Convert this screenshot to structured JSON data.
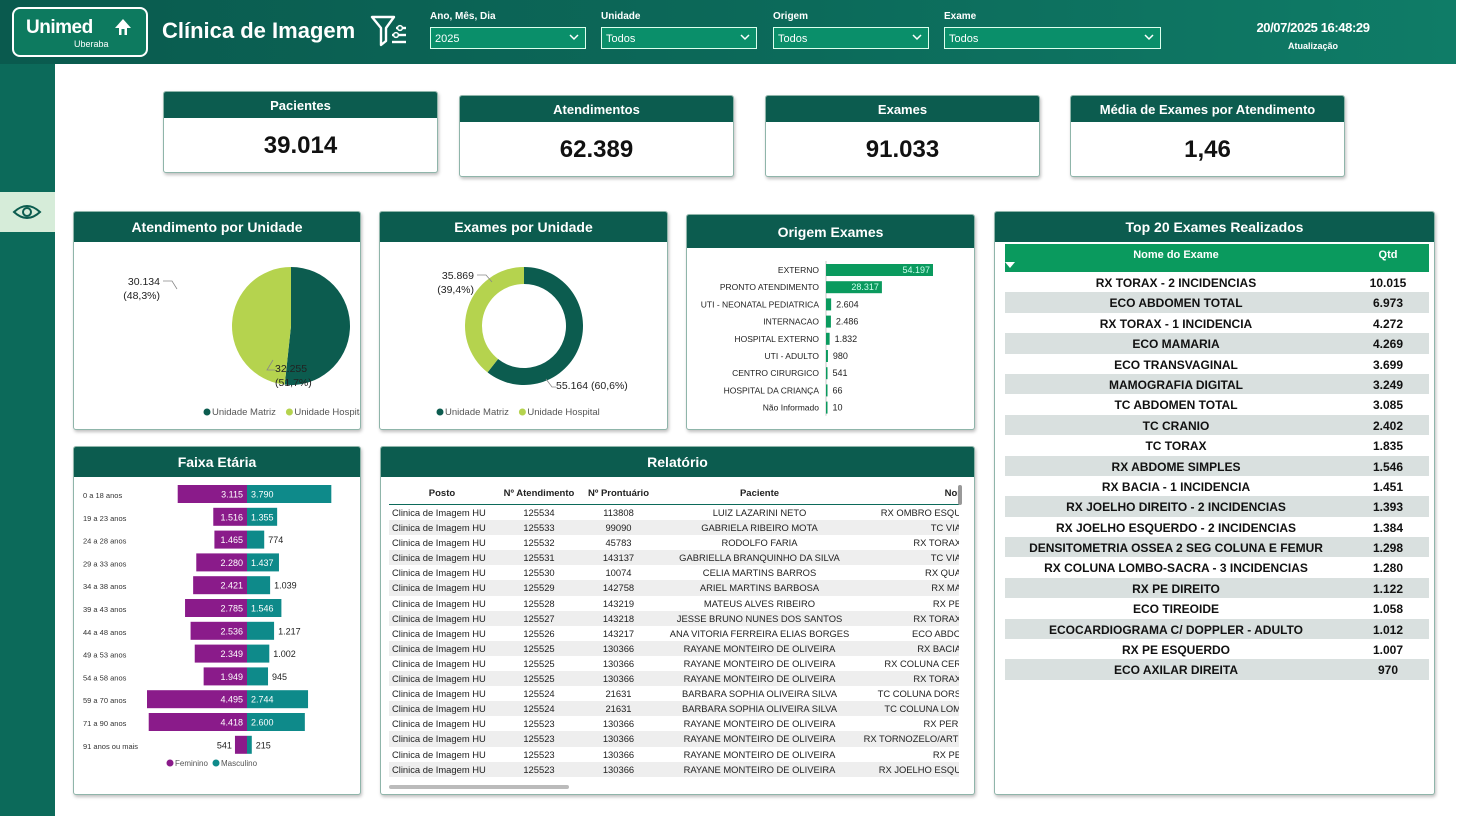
{
  "header": {
    "logo_name": "Unimed",
    "logo_sub": "Uberaba",
    "title": "Clínica de Imagem",
    "filters": [
      {
        "label": "Ano, Mês, Dia",
        "value": "2025"
      },
      {
        "label": "Unidade",
        "value": "Todos"
      },
      {
        "label": "Origem",
        "value": "Todos"
      },
      {
        "label": "Exame",
        "value": "Todos"
      }
    ],
    "timestamp": "20/07/2025 16:48:29",
    "timestamp_label": "Atualização"
  },
  "kpis": [
    {
      "label": "Pacientes",
      "value": "39.014"
    },
    {
      "label": "Atendimentos",
      "value": "62.389"
    },
    {
      "label": "Exames",
      "value": "91.033"
    },
    {
      "label": "Média de Exames por Atendimento",
      "value": "1,46"
    }
  ],
  "colors": {
    "dark_green": "#0c5c4f",
    "light_green": "#b5d34e",
    "bar_green": "#0a9a5e",
    "purple": "#8a1b8a",
    "teal": "#0e8a8a"
  },
  "icons": [
    "filter-icon",
    "eye-icon",
    "chevron-down-icon",
    "sort-down-icon"
  ],
  "relatorio": {
    "title": "Relatório",
    "columns": [
      "Posto",
      "Nº Atendimento",
      "Nº Prontuário",
      "Paciente",
      "Nor"
    ],
    "rows": [
      [
        "Clinica de Imagem HU",
        "125534",
        "113808",
        "LUIZ LAZARINI NETO",
        "RX OMBRO ESQU"
      ],
      [
        "Clinica de Imagem HU",
        "125533",
        "99090",
        "GABRIELA RIBEIRO MOTA",
        "TC VIA"
      ],
      [
        "Clinica de Imagem HU",
        "125532",
        "45783",
        "RODOLFO FARIA",
        "RX TORAX"
      ],
      [
        "Clinica de Imagem HU",
        "125531",
        "143137",
        "GABRIELLA BRANQUINHO DA SILVA",
        "TC VIA"
      ],
      [
        "Clinica de Imagem HU",
        "125530",
        "10074",
        "CELIA MARTINS BARROS",
        "RX QUA"
      ],
      [
        "Clinica de Imagem HU",
        "125529",
        "142758",
        "ARIEL MARTINS BARBOSA",
        "RX MA"
      ],
      [
        "Clinica de Imagem HU",
        "125528",
        "143219",
        "MATEUS ALVES RIBEIRO",
        "RX PE"
      ],
      [
        "Clinica de Imagem HU",
        "125527",
        "143218",
        "JESSE BRUNO NUNES DOS SANTOS",
        "RX TORAX"
      ],
      [
        "Clinica de Imagem HU",
        "125526",
        "143217",
        "ANA VITORIA FERREIRA ELIAS BORGES",
        "ECO ABDO"
      ],
      [
        "Clinica de Imagem HU",
        "125525",
        "130366",
        "RAYANE MONTEIRO DE OLIVEIRA",
        "RX BACIA"
      ],
      [
        "Clinica de Imagem HU",
        "125525",
        "130366",
        "RAYANE MONTEIRO DE OLIVEIRA",
        "RX COLUNA CER"
      ],
      [
        "Clinica de Imagem HU",
        "125525",
        "130366",
        "RAYANE MONTEIRO DE OLIVEIRA",
        "RX TORAX"
      ],
      [
        "Clinica de Imagem HU",
        "125524",
        "21631",
        "BARBARA SOPHIA OLIVEIRA SILVA",
        "TC COLUNA DORS"
      ],
      [
        "Clinica de Imagem HU",
        "125524",
        "21631",
        "BARBARA SOPHIA OLIVEIRA SILVA",
        "TC COLUNA LOM"
      ],
      [
        "Clinica de Imagem HU",
        "125523",
        "130366",
        "RAYANE MONTEIRO DE OLIVEIRA",
        "RX PERI"
      ],
      [
        "Clinica de Imagem HU",
        "125523",
        "130366",
        "RAYANE MONTEIRO DE OLIVEIRA",
        "RX TORNOZELO/ARTI"
      ],
      [
        "Clinica de Imagem HU",
        "125523",
        "130366",
        "RAYANE MONTEIRO DE OLIVEIRA",
        "RX PE"
      ],
      [
        "Clinica de Imagem HU",
        "125523",
        "130366",
        "RAYANE MONTEIRO DE OLIVEIRA",
        "RX JOELHO ESQU"
      ]
    ]
  },
  "top20": {
    "title": "Top 20 Exames Realizados",
    "col_name": "Nome do Exame",
    "col_qtd": "Qtd",
    "rows": [
      [
        "RX TORAX - 2 INCIDENCIAS",
        "10.015"
      ],
      [
        "ECO ABDOMEN TOTAL",
        "6.973"
      ],
      [
        "RX TORAX - 1 INCIDENCIA",
        "4.272"
      ],
      [
        "ECO MAMARIA",
        "4.269"
      ],
      [
        "ECO TRANSVAGINAL",
        "3.699"
      ],
      [
        "MAMOGRAFIA DIGITAL",
        "3.249"
      ],
      [
        "TC ABDOMEN TOTAL",
        "3.085"
      ],
      [
        "TC CRANIO",
        "2.402"
      ],
      [
        "TC TORAX",
        "1.835"
      ],
      [
        "RX ABDOME SIMPLES",
        "1.546"
      ],
      [
        "RX BACIA - 1 INCIDENCIA",
        "1.451"
      ],
      [
        "RX JOELHO DIREITO - 2 INCIDENCIAS",
        "1.393"
      ],
      [
        "RX JOELHO ESQUERDO - 2 INCIDENCIAS",
        "1.384"
      ],
      [
        "DENSITOMETRIA OSSEA 2 SEG COLUNA E FEMUR",
        "1.298"
      ],
      [
        "RX COLUNA LOMBO-SACRA - 3 INCIDENCIAS",
        "1.280"
      ],
      [
        "RX PE DIREITO",
        "1.122"
      ],
      [
        "ECO TIREOIDE",
        "1.058"
      ],
      [
        "ECOCARDIOGRAMA C/ DOPPLER - ADULTO",
        "1.012"
      ],
      [
        "RX PE ESQUERDO",
        "1.007"
      ],
      [
        "ECO AXILAR DIREITA",
        "970"
      ]
    ]
  },
  "chart_data": [
    {
      "type": "pie",
      "title": "Atendimento por Unidade",
      "categories": [
        "Unidade Matriz",
        "Unidade Hospital"
      ],
      "values": [
        32255,
        30134
      ],
      "labels": [
        [
          "32.255",
          "(51,7%)"
        ],
        [
          "30.134",
          "(48,3%)"
        ]
      ],
      "legend": "bottom"
    },
    {
      "type": "pie",
      "title": "Exames por Unidade",
      "categories": [
        "Unidade Matriz",
        "Unidade Hospital"
      ],
      "values": [
        55164,
        35869
      ],
      "labels": [
        [
          "55.164 (60,6%)"
        ],
        [
          "35.869",
          "(39,4%)"
        ]
      ],
      "legend": "bottom"
    },
    {
      "type": "bar",
      "title": "Origem Exames",
      "categories": [
        "EXTERNO",
        "PRONTO ATENDIMENTO",
        "UTI - NEONATAL PEDIATRICA",
        "INTERNACAO",
        "HOSPITAL EXTERNO",
        "UTI - ADULTO",
        "CENTRO CIRURGICO",
        "HOSPITAL DA CRIANÇA",
        "Não Informado"
      ],
      "values": [
        54197,
        28317,
        2604,
        2486,
        1832,
        980,
        541,
        66,
        10
      ],
      "labels": [
        "54.197",
        "28.317",
        "2.604",
        "2.486",
        "1.832",
        "980",
        "541",
        "66",
        "10"
      ]
    },
    {
      "type": "bar",
      "title": "Faixa Etária",
      "categories": [
        "0 a 18 anos",
        "19 a 23 anos",
        "24 a 28 anos",
        "29 a 33 anos",
        "34 a 38 anos",
        "39 a 43 anos",
        "44 a 48 anos",
        "49 a 53 anos",
        "54 a 58 anos",
        "59 a 70 anos",
        "71 a 90 anos",
        "91 anos ou mais"
      ],
      "series": [
        {
          "name": "Feminino",
          "values": [
            3115,
            1516,
            1465,
            2280,
            2421,
            2785,
            2536,
            2349,
            1949,
            4495,
            4418,
            541
          ],
          "labels": [
            "3.115",
            "1.516",
            "1.465",
            "2.280",
            "2.421",
            "2.785",
            "2.536",
            "2.349",
            "1.949",
            "4.495",
            "4.418",
            "541"
          ]
        },
        {
          "name": "Masculino",
          "values": [
            3790,
            1355,
            774,
            1437,
            1039,
            1546,
            1217,
            1002,
            945,
            2744,
            2600,
            215
          ],
          "labels": [
            "3.790",
            "1.355",
            "774",
            "1.437",
            "1.039",
            "1.546",
            "1.217",
            "1.002",
            "945",
            "2.744",
            "2.600",
            "215"
          ]
        }
      ],
      "legend": "bottom"
    }
  ]
}
